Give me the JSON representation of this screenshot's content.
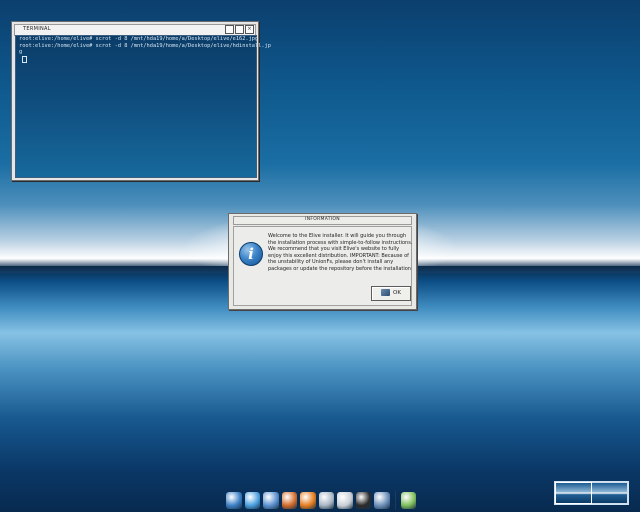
{
  "terminal": {
    "title": "TERMINAL",
    "lines": [
      "root:elive:/home/elive# scrot -d 8 /mnt/hda19/home/a/Desktop/elive/e162.jpg",
      "root:elive:/home/elive# scrot -d 8 /mnt/hda19/home/a/Desktop/elive/hdinstall.jp",
      "g"
    ],
    "buttons": [
      "minimize",
      "maximize",
      "close"
    ]
  },
  "dialog": {
    "title": "INFORMATION",
    "icon": "info-icon",
    "message_lines": [
      "Welcome to the Elive installer. It will guide you through",
      "the installation process  with simple-to-follow instructions.",
      "We recommend that you visit Elive's website to fully",
      "enjoy  this excellent distribution. IMPORTANT: Because of",
      "the unstability of UnionFs, please don't install any",
      "packages or update the repository before the installation"
    ],
    "ok_label": "OK"
  },
  "dock": {
    "icons": [
      {
        "name": "monitor-icon",
        "color": "#3a7fc4"
      },
      {
        "name": "network-globe-icon",
        "color": "#4aa0e0"
      },
      {
        "name": "file-manager-icon",
        "color": "#5b8fd0"
      },
      {
        "name": "notes-icon",
        "color": "#d26b2a"
      },
      {
        "name": "firefox-icon",
        "color": "#e57c1e"
      },
      {
        "name": "settings-gear-icon",
        "color": "#a9b6c4"
      },
      {
        "name": "media-player-icon",
        "color": "#c9ced6"
      },
      {
        "name": "terminal-icon",
        "color": "#2b2b2b"
      },
      {
        "name": "image-viewer-icon",
        "color": "#6b8fb8"
      },
      {
        "name": "installer-icon",
        "color": "#7fbf5a"
      }
    ]
  },
  "pager": {
    "desks": 2,
    "active": 0
  }
}
